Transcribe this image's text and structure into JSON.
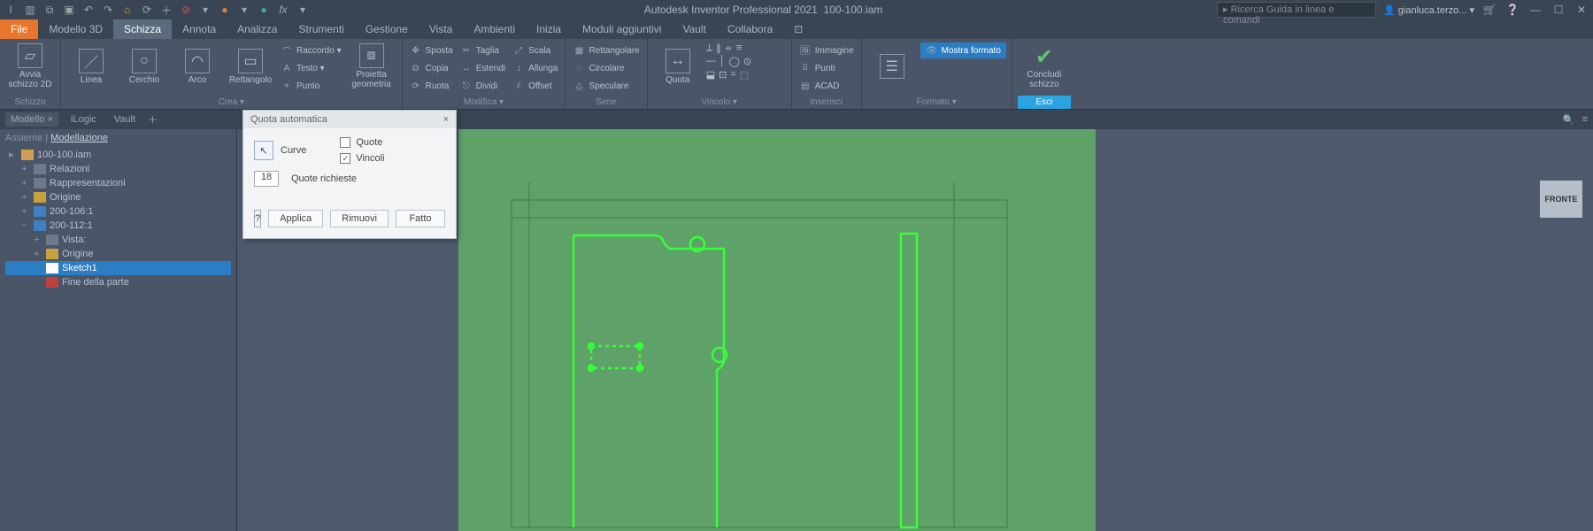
{
  "title": {
    "app": "Autodesk Inventor Professional 2021",
    "doc": "100-100.iam"
  },
  "titlebar": {
    "search_placeholder": "Ricerca Guida in linea e comandi",
    "user": "gianluca.terzo..."
  },
  "tabs": {
    "file": "File",
    "items": [
      "Modello 3D",
      "Schizza",
      "Annota",
      "Analizza",
      "Strumenti",
      "Gestione",
      "Vista",
      "Ambienti",
      "Inizia",
      "Moduli aggiuntivi",
      "Vault",
      "Collabora"
    ],
    "active_index": 1
  },
  "ribbon": {
    "panels": {
      "schizzo": {
        "title": "Schizzo",
        "start": "Avvia\nschizzo 2D"
      },
      "crea": {
        "title": "Crea ▾",
        "linea": "Linea",
        "cerchio": "Cerchio",
        "arco": "Arco",
        "rettangolo": "Rettangolo",
        "raccordo": "Raccordo ▾",
        "testo": "Testo ▾",
        "punto": "Punto",
        "proietta": "Proietta\ngeometria"
      },
      "modifica": {
        "title": "Modifica ▾",
        "sposta": "Sposta",
        "taglia": "Taglia",
        "scala": "Scala",
        "copia": "Copia",
        "estendi": "Estendi",
        "allunga": "Allunga",
        "ruota": "Ruota",
        "dividi": "Dividi",
        "offset": "Offset"
      },
      "serie": {
        "title": "Serie",
        "rettangolare": "Rettangolare",
        "circolare": "Circolare",
        "speculare": "Speculare"
      },
      "vincolo": {
        "title": "Vincolo ▾",
        "quota": "Quota"
      },
      "inserisci": {
        "title": "Inserisci",
        "immagine": "Immagine",
        "punti": "Punti",
        "acad": "ACAD"
      },
      "formato": {
        "title": "Formato ▾",
        "mostra": "Mostra formato"
      },
      "esci": {
        "title": "Esci",
        "concludi": "Concludi\nschizzo"
      }
    }
  },
  "browser": {
    "tabs": {
      "modello": "Modello",
      "logic": "iLogic",
      "vault": "Vault"
    },
    "crumbs": {
      "a": "Assieme",
      "b": "Modellazione"
    },
    "tree": {
      "root": "100-100.iam",
      "relazioni": "Relazioni",
      "rappresentazioni": "Rappresentazioni",
      "origine": "Origine",
      "p1": "200-106:1",
      "p2": "200-112:1",
      "vista": "Vista:",
      "origine2": "Origine",
      "sketch": "Sketch1",
      "fine": "Fine della parte"
    }
  },
  "dialog": {
    "title": "Quota automatica",
    "mode": "Curve",
    "chk_quote": "Quote",
    "chk_vincoli": "Vincoli",
    "req_value": "18",
    "req_label": "Quote richieste",
    "btn_applica": "Applica",
    "btn_rimuovi": "Rimuovi",
    "btn_fatto": "Fatto"
  },
  "viewcube": "FRONTE"
}
